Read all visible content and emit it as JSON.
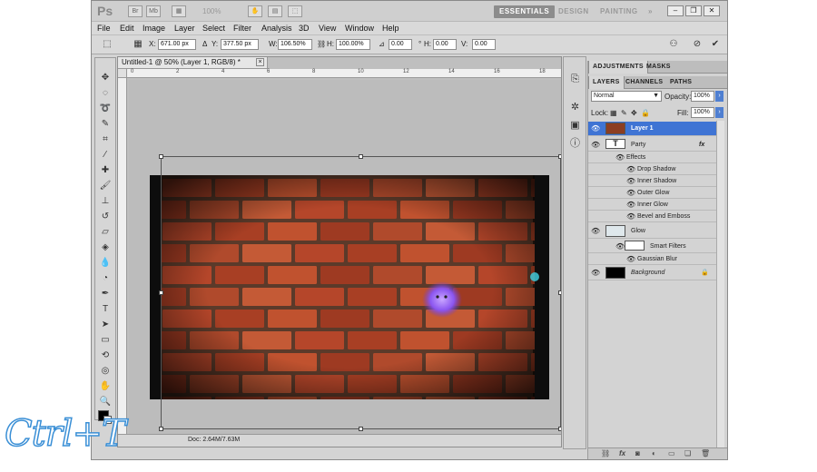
{
  "appbar": {
    "logo": "Ps",
    "zoom": "100%",
    "workspaces": [
      "ESSENTIALS",
      "DESIGN",
      "PAINTING",
      "»"
    ],
    "active_workspace": "ESSENTIALS"
  },
  "menu": [
    "File",
    "Edit",
    "Image",
    "Layer",
    "Select",
    "Filter",
    "Analysis",
    "3D",
    "View",
    "Window",
    "Help"
  ],
  "options": {
    "x_label": "X:",
    "x_value": "671.00 px",
    "y_label": "Y:",
    "y_value": "377.50 px",
    "w_label": "W:",
    "w_value": "106.50%",
    "h_label": "H:",
    "h_value": "100.00%",
    "rot_value": "0.00",
    "hskew_label": "H:",
    "hskew_value": "0.00",
    "vskew_label": "V:",
    "vskew_value": "0.00"
  },
  "document": {
    "tab_title": "Untitled-1 @ 50% (Layer 1, RGB/8) *",
    "ruler_ticks": [
      "0",
      "2",
      "4",
      "6",
      "8",
      "10",
      "12",
      "14",
      "16",
      "18"
    ],
    "status": "Doc: 2.64M/7.63M"
  },
  "panels": {
    "top_tabs": [
      "ADJUSTMENTS",
      "MASKS"
    ],
    "layer_tabs": [
      "LAYERS",
      "CHANNELS",
      "PATHS"
    ],
    "blend_mode": "Normal",
    "opacity_label": "Opacity:",
    "opacity_value": "100%",
    "lock_label": "Lock:",
    "fill_label": "Fill:",
    "fill_value": "100%",
    "layers": [
      {
        "name": "Layer 1",
        "kind": "image",
        "selected": true
      },
      {
        "name": "Party",
        "kind": "text",
        "fx": "fx"
      },
      {
        "name": "Effects",
        "kind": "effects-header"
      },
      {
        "name": "Drop Shadow",
        "kind": "effect"
      },
      {
        "name": "Inner Shadow",
        "kind": "effect"
      },
      {
        "name": "Outer Glow",
        "kind": "effect"
      },
      {
        "name": "Inner Glow",
        "kind": "effect"
      },
      {
        "name": "Bevel and Emboss",
        "kind": "effect"
      },
      {
        "name": "Glow",
        "kind": "smart"
      },
      {
        "name": "Smart Filters",
        "kind": "filter-header"
      },
      {
        "name": "Gaussian Blur",
        "kind": "filter"
      },
      {
        "name": "Background",
        "kind": "background"
      }
    ]
  },
  "watermark": "Ctrl+T",
  "colors": {
    "selection_blue": "#3f74d4",
    "brick": "#b5462a",
    "glow_purple": "#8b55f0"
  }
}
